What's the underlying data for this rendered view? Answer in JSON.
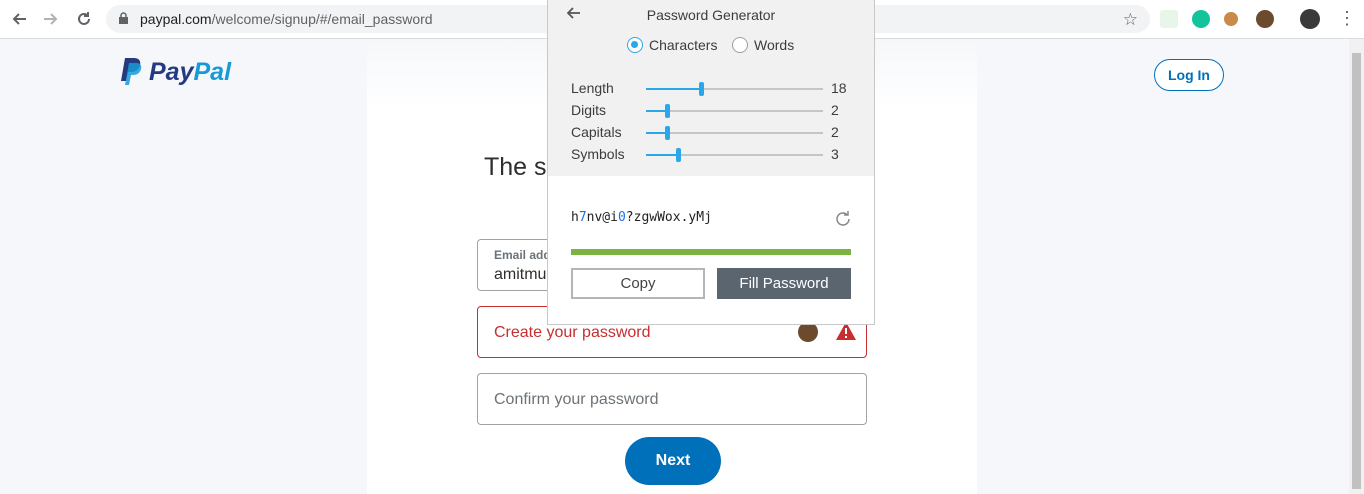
{
  "browser": {
    "url_host": "paypal.com",
    "url_path": "/welcome/signup/#/email_password"
  },
  "page": {
    "brand_pay": "Pay",
    "brand_pal": "Pal",
    "login_label": "Log In",
    "headline": "The sa",
    "email_label": "Email add",
    "email_value": "amitmu",
    "password_placeholder": "Create your password",
    "confirm_placeholder": "Confirm your password",
    "next_label": "Next"
  },
  "generator": {
    "title": "Password Generator",
    "mode_characters": "Characters",
    "mode_words": "Words",
    "selected_mode": "Characters",
    "sliders": [
      {
        "label": "Length",
        "value": "18",
        "fraction": 0.31
      },
      {
        "label": "Digits",
        "value": "2",
        "fraction": 0.12
      },
      {
        "label": "Capitals",
        "value": "2",
        "fraction": 0.12
      },
      {
        "label": "Symbols",
        "value": "3",
        "fraction": 0.18
      }
    ],
    "password_parts": [
      "h",
      "7",
      "nv@i",
      "0",
      "?zgwWox.yMj"
    ],
    "strength": 1.0,
    "copy_label": "Copy",
    "fill_label": "Fill Password"
  },
  "colors": {
    "accent": "#0070ba",
    "error": "#c72e2f",
    "slider": "#2aa7e8",
    "strength": "#7cb342"
  }
}
